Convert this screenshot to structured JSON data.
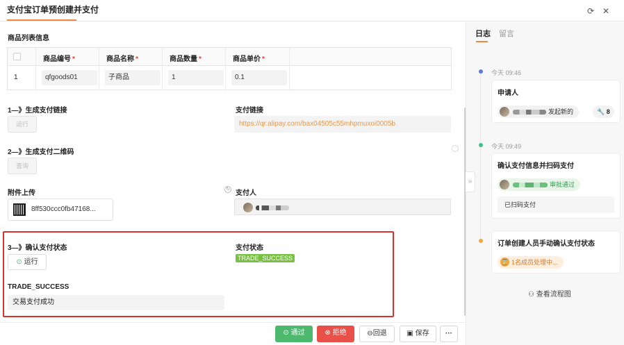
{
  "window": {
    "title": "支付宝订单预创建并支付",
    "refresh_icon": "refresh-icon",
    "close_icon": "close-icon"
  },
  "goods": {
    "section_label": "商品列表信息",
    "columns": [
      "商品编号",
      "商品名称",
      "商品数量",
      "商品单价"
    ],
    "required_mark": "*",
    "rows": [
      {
        "index": "1",
        "code": "qfgoods01",
        "name": "子商品",
        "qty": "1",
        "price": "0.1"
      }
    ]
  },
  "step1": {
    "label": "1—》生成支付链接",
    "run_button": "运行",
    "link_label": "支付链接",
    "link_value": "https://qr.alipay.com/bax04505c55mhpmuxoi0005b"
  },
  "step2": {
    "label": "2—》生成支付二维码",
    "query_button": "查询"
  },
  "attachment": {
    "label": "附件上传",
    "file_name": "8ff530ccc0fb47168...",
    "payer_label": "支付人"
  },
  "step3": {
    "label": "3—》确认支付状态",
    "run_button": "运行",
    "status_label": "支付状态",
    "status_value": "TRADE_SUCCESS",
    "result_label": "TRADE_SUCCESS",
    "result_value": "交易支付成功"
  },
  "toolbar": {
    "approve": "通过",
    "reject": "拒绝",
    "return": "回退",
    "save": "保存",
    "more": "···"
  },
  "right_panel": {
    "tabs": [
      "日志",
      "留言"
    ],
    "timeline": [
      {
        "time": "今天 09:46",
        "title": "申请人",
        "pill": "发起新的",
        "count": "8",
        "dot_color": "#5b7bd5"
      },
      {
        "time": "今天 09:49",
        "title": "确认支付信息并扫码支付",
        "pill": "审批通过",
        "note": "已扫码支付",
        "dot_color": "#3cc28a"
      },
      {
        "time": "",
        "title": "订单创建人员手动确认支付状态",
        "pill": "1名成员处理中...",
        "dot_color": "#f0a93e"
      }
    ],
    "flow_link": "查看流程图"
  },
  "colors": {
    "accent": "#f0883e",
    "approve": "#4cb96f",
    "reject": "#e9504a",
    "success_tag": "#79c143",
    "highlight_border": "#d9312b"
  }
}
